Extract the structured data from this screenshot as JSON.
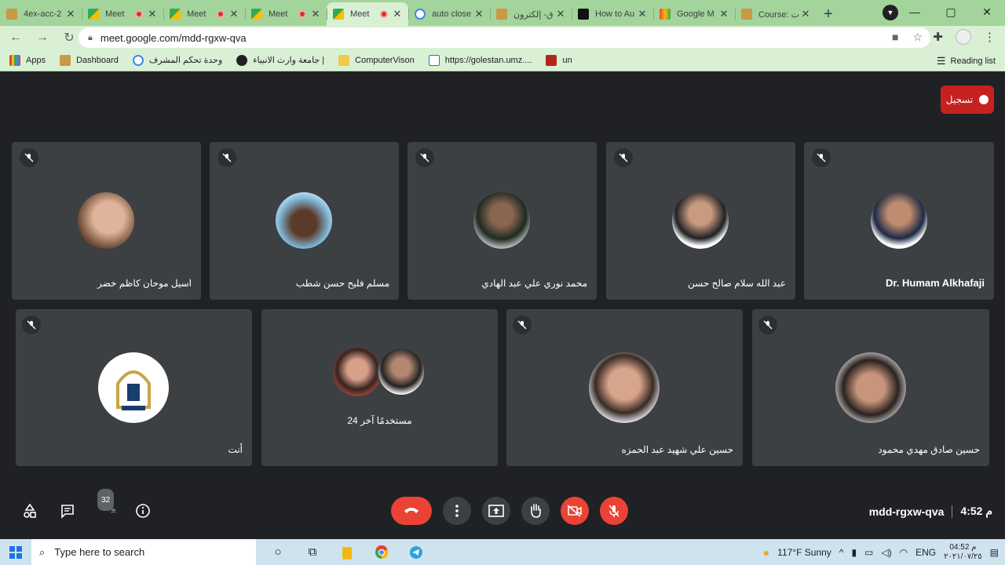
{
  "browser": {
    "tabs": [
      {
        "title": "4ex-acc-2",
        "recording": false,
        "active": false
      },
      {
        "title": "Meet",
        "recording": true,
        "active": false
      },
      {
        "title": "Meet",
        "recording": true,
        "active": false
      },
      {
        "title": "Meet",
        "recording": true,
        "active": false
      },
      {
        "title": "Meet",
        "recording": true,
        "active": true
      },
      {
        "title": "auto close",
        "recording": false,
        "active": false
      },
      {
        "title": "ق- إلكترون",
        "recording": false,
        "active": false
      },
      {
        "title": "How to Au",
        "recording": false,
        "active": false
      },
      {
        "title": "Google M",
        "recording": false,
        "active": false
      },
      {
        "title": "Course: ت",
        "recording": false,
        "active": false
      }
    ],
    "url": "meet.google.com/mdd-rgxw-qva",
    "bookmarks": [
      {
        "label": "Apps",
        "icon": "apps-grid-icon"
      },
      {
        "label": "Dashboard",
        "icon": "dashboard-icon"
      },
      {
        "label": "وحدة تحكم المشرف",
        "icon": "google-icon"
      },
      {
        "label": "جامعة وارث الانبياء |",
        "icon": "globe-icon"
      },
      {
        "label": "ComputerVison",
        "icon": "folder-icon"
      },
      {
        "label": "https://golestan.umz....",
        "icon": "site-icon"
      },
      {
        "label": "un",
        "icon": "site-icon"
      }
    ],
    "reading_list": "Reading list"
  },
  "meet": {
    "record_label": "تسجيل",
    "participants": [
      {
        "name": "اسيل موحان كاظم خضر",
        "bold": false
      },
      {
        "name": "مسلم فليح حسن شطب",
        "bold": false
      },
      {
        "name": "محمد نوري علي عبد الهادي",
        "bold": false
      },
      {
        "name": "عبد الله سلام صالح حسن",
        "bold": false
      },
      {
        "name": "Dr. Humam Alkhafaji",
        "bold": true
      },
      {
        "name": "أنت",
        "bold": false
      },
      {
        "name": "24 مستخدمًا آخر",
        "bold": false
      },
      {
        "name": "حسين علي شهيد عبد الحمزه",
        "bold": false
      },
      {
        "name": "حسين صادق مهدي محمود",
        "bold": false
      }
    ],
    "people_count": "32",
    "meeting_code": "mdd-rgxw-qva",
    "time": "4:52 م"
  },
  "taskbar": {
    "search_placeholder": "Type here to search",
    "weather": "117°F  Sunny",
    "lang": "ENG",
    "clock_time": "04:52 م",
    "clock_date": "٢٠٢١/٠٧/٢٥"
  },
  "colors": {
    "tab_strip": "#a3d49b",
    "toolbar": "#d9f0d4",
    "meet_bg": "#202124",
    "tile_bg": "#3c4043",
    "danger": "#ea4335"
  }
}
